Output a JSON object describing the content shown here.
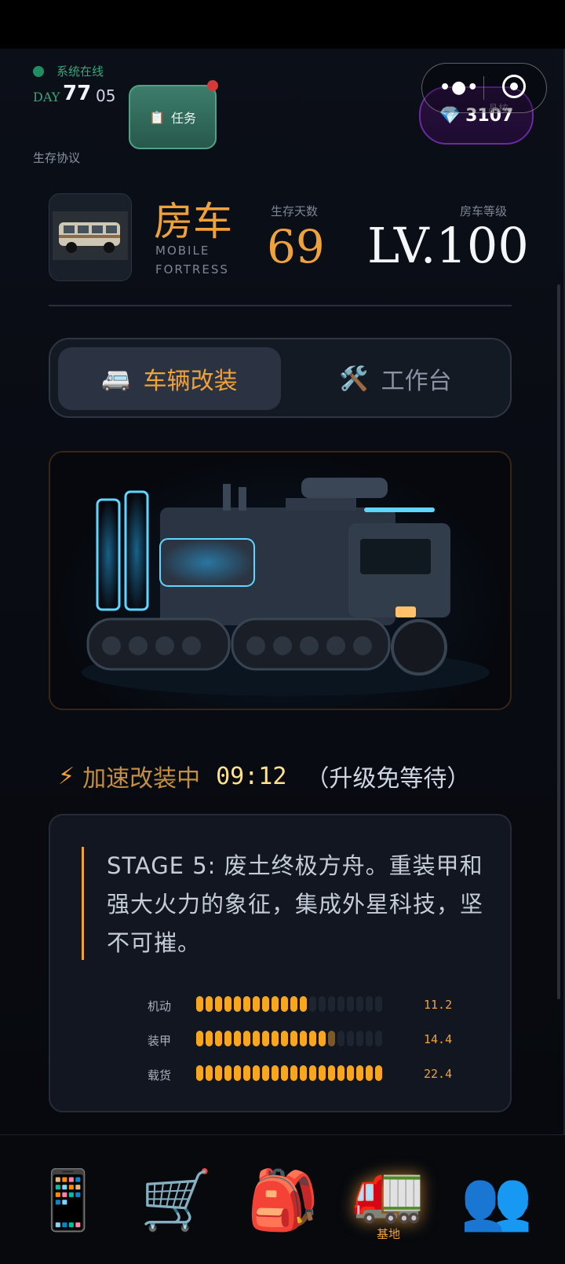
{
  "status": {
    "online_text": "系统在线",
    "day_label": "DAY",
    "day_number": "77",
    "day_sub": "05",
    "protocol_label": "生存协议"
  },
  "task_button": {
    "icon": "clipboard-icon",
    "icon_glyph": "📋",
    "label": "任务"
  },
  "gems": {
    "icon_glyph": "💎",
    "amount": "3107",
    "core_label": "晶核"
  },
  "vehicle": {
    "title_cn": "房车",
    "title_en_line1": "MOBILE",
    "title_en_line2": "FORTRESS",
    "days_label": "生存天数",
    "days_value": "69",
    "level_label": "房车等级",
    "level_value": "LV.100"
  },
  "tabs": [
    {
      "label": "车辆改装",
      "icon_glyph": "🚐",
      "active": true
    },
    {
      "label": "工作台",
      "icon_glyph": "🛠️",
      "active": false
    }
  ],
  "upgrade": {
    "bolt_glyph": "⚡",
    "status_text": "加速改装中",
    "timer": "09:12",
    "note": "（升级免等待）"
  },
  "description": "STAGE 5: 废土终极方舟。重装甲和强大火力的象征，集成外星科技，坚不可摧。",
  "stats": [
    {
      "label": "机动",
      "value": "11.2",
      "filled": 12,
      "partial": 0,
      "total": 20
    },
    {
      "label": "装甲",
      "value": "14.4",
      "filled": 14,
      "partial": 1,
      "total": 20
    },
    {
      "label": "载货",
      "value": "22.4",
      "filled": 20,
      "partial": 0,
      "total": 20
    }
  ],
  "bottom_nav": [
    {
      "name": "phone",
      "icon_glyph": "📱",
      "label": "",
      "active": false
    },
    {
      "name": "shop",
      "icon_glyph": "🛒",
      "label": "",
      "active": false
    },
    {
      "name": "backpack",
      "icon_glyph": "🎒",
      "label": "",
      "active": false
    },
    {
      "name": "base",
      "icon_glyph": "🚛",
      "label": "基地",
      "active": true
    },
    {
      "name": "team",
      "icon_glyph": "👥",
      "label": "",
      "active": false
    }
  ],
  "colors": {
    "accent": "#f0a23a",
    "online": "#3aa57a",
    "gem_border": "#6b2aa1",
    "task_bg": "#3d7d6b"
  }
}
